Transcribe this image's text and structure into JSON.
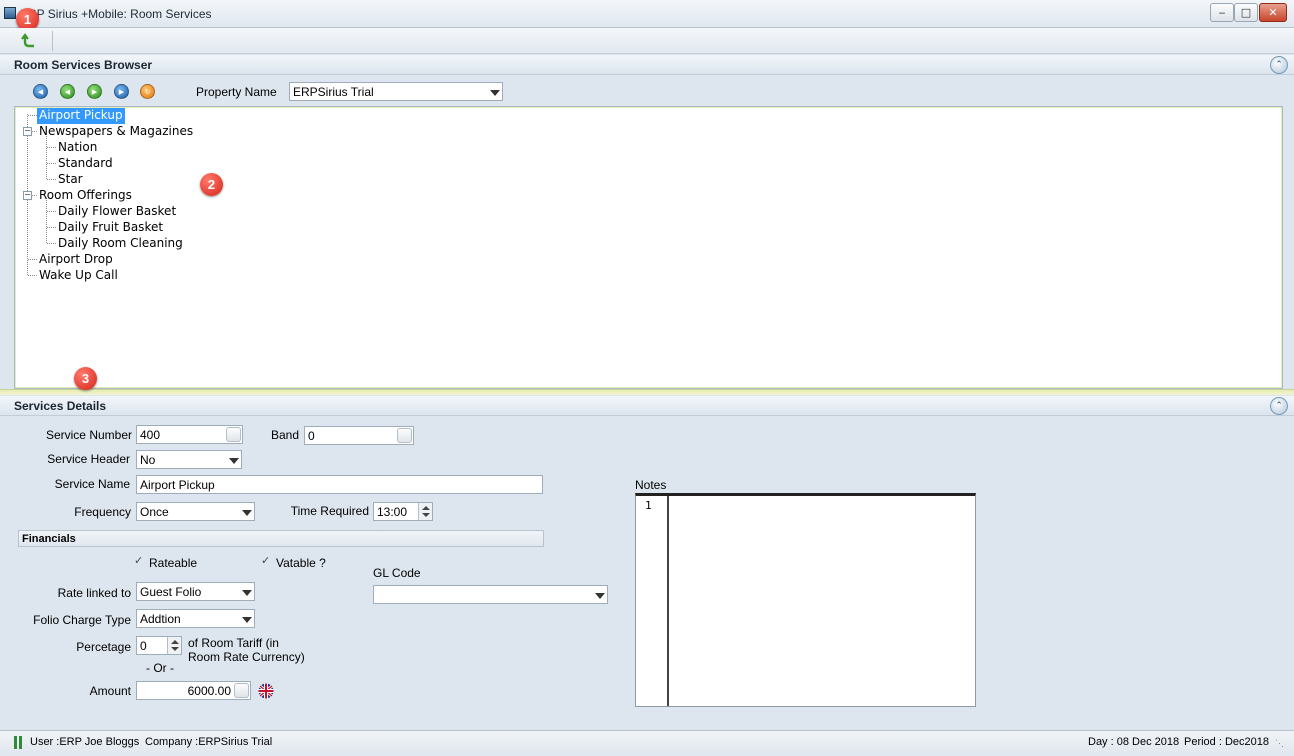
{
  "window": {
    "title": "ERP Sirius +Mobile: Room Services",
    "minimize_icon": "minimize-icon",
    "maximize_icon": "maximize-icon",
    "close_icon": "close-icon"
  },
  "annotations": [
    "1",
    "2",
    "3"
  ],
  "toolbar": {
    "back_icon": "green-return-arrow-icon"
  },
  "browser": {
    "title": "Room Services Browser",
    "nav_icons": [
      "first-icon",
      "previous-icon",
      "next-icon",
      "last-icon",
      "refresh-icon"
    ],
    "property_label": "Property Name",
    "property_value": "ERPSirius Trial",
    "tree": [
      {
        "label": "Airport Pickup",
        "selected": true
      },
      {
        "label": "Newspapers & Magazines",
        "children": [
          "Nation",
          "Standard",
          "Star"
        ]
      },
      {
        "label": "Room Offerings",
        "children": [
          "Daily Flower Basket",
          "Daily Fruit Basket",
          "Daily Room Cleaning"
        ]
      },
      {
        "label": "Airport Drop"
      },
      {
        "label": "Wake Up Call"
      }
    ]
  },
  "details": {
    "title": "Services Details",
    "service_number_label": "Service Number",
    "service_number": "400",
    "band_label": "Band",
    "band": "0",
    "service_header_label": "Service Header",
    "service_header": "No",
    "service_name_label": "Service Name",
    "service_name": "Airport Pickup",
    "frequency_label": "Frequency",
    "frequency": "Once",
    "time_required_label": "Time Required",
    "time_required": "13:00",
    "financials_label": "Financials",
    "rateable_label": "Rateable",
    "rateable": true,
    "vatable_label": "Vatable ?",
    "vatable": true,
    "gl_code_label": "GL Code",
    "gl_code": "",
    "rate_linked_label": "Rate linked to",
    "rate_linked": "Guest Folio",
    "folio_charge_label": "Folio Charge Type",
    "folio_charge": "Addtion",
    "percentage_label": "Percetage",
    "percentage": "0",
    "tariff_note_1": "of Room Tariff (in",
    "tariff_note_2": "Room Rate Currency)",
    "or_label": "- Or -",
    "amount_label": "Amount",
    "amount": "6000.00",
    "currency_icon": "uk-flag-icon",
    "notes_label": "Notes",
    "notes_line": "1"
  },
  "status": {
    "user": "User :ERP Joe Bloggs",
    "company": "Company :ERPSirius Trial",
    "day": "Day : 08 Dec 2018",
    "period": "Period : Dec2018"
  },
  "colors": {
    "selection": "#3399ff",
    "badge": "#d7241c",
    "window_bg": "#dde6ee"
  }
}
